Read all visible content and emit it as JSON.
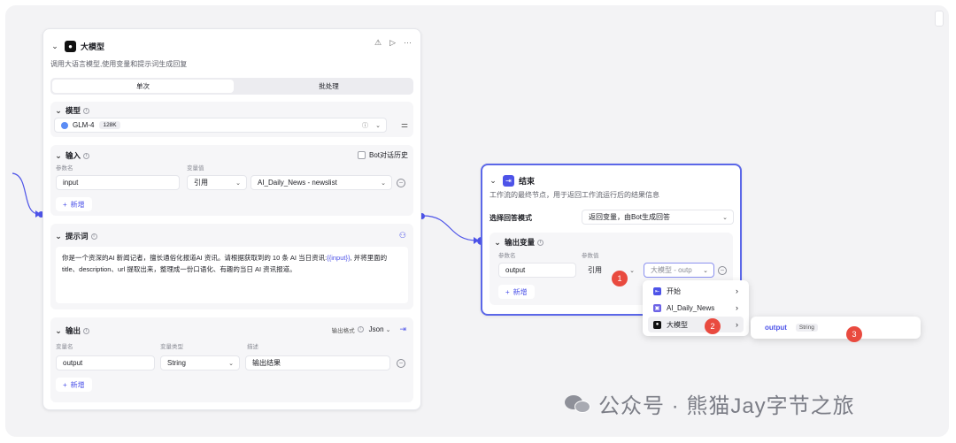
{
  "llm_node": {
    "title": "大模型",
    "description": "调用大语言模型,使用变量和提示词生成回复",
    "tabs": [
      "单次",
      "批处理"
    ],
    "model": {
      "section_title": "模型",
      "name": "GLM-4",
      "tag": "128K"
    },
    "input": {
      "section_title": "输入",
      "history_label": "Bot对话历史",
      "col_name": "参数名",
      "col_value": "变量值",
      "param_name": "input",
      "ref_type": "引用",
      "ref_value": "AI_Daily_News - newslist",
      "add_label": "新增"
    },
    "prompt": {
      "section_title": "提示词",
      "text_before": "你是一个资深的AI 新闻记者，擅长通俗化报道AI 资讯。请根据获取到的 10 条 AI 当日资讯:",
      "variable": "{{input}}",
      "text_after": ", 并将里面的title、description、url 提取出来，整理成一份口语化、有趣的当日 AI 资讯报道。"
    },
    "output": {
      "section_title": "输出",
      "format_label": "输出格式",
      "format_value": "Json",
      "col_name": "变量名",
      "col_type": "变量类型",
      "col_desc": "描述",
      "var_name": "output",
      "var_type": "String",
      "var_desc": "输出结果",
      "add_label": "新增"
    }
  },
  "end_node": {
    "title": "结束",
    "description": "工作流的最终节点，用于返回工作流运行后的结果信息",
    "mode_label": "选择回答模式",
    "mode_value": "返回变量，由Bot生成回答",
    "section_title": "输出变量",
    "col_name": "参数名",
    "col_value": "参数值",
    "param_name": "output",
    "ref_type": "引用",
    "ref_value": "大模型 - outp",
    "add_label": "新增"
  },
  "dropdown": {
    "items": [
      "开始",
      "AI_Daily_News",
      "大模型"
    ]
  },
  "submenu": {
    "name": "output",
    "type": "String"
  },
  "markers": [
    "1",
    "2",
    "3"
  ],
  "watermark": "公众号 · 熊猫Jay字节之旅",
  "colors": {
    "accent": "#4d53e8",
    "marker": "#e94a3f"
  }
}
